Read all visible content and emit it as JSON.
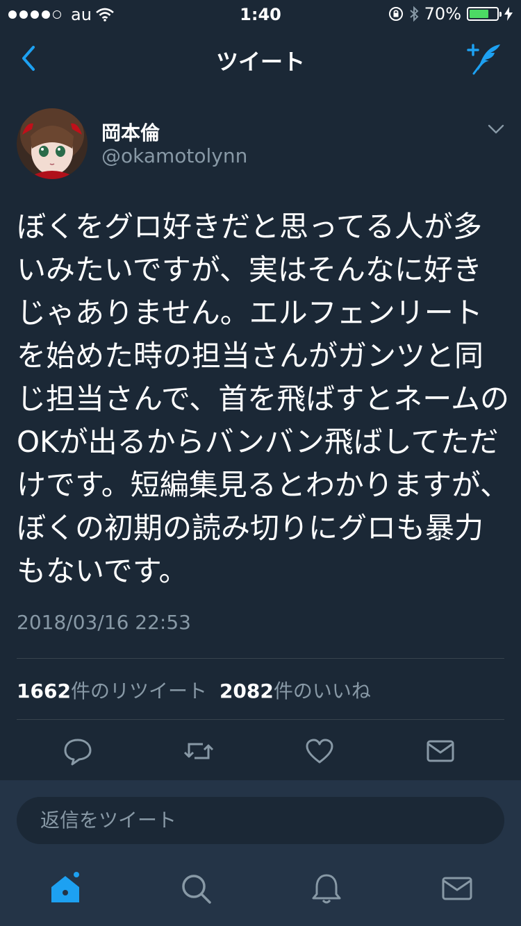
{
  "status_bar": {
    "carrier": "au",
    "time": "1:40",
    "battery": "70%",
    "battery_level": 0.7
  },
  "nav": {
    "title": "ツイート"
  },
  "tweet": {
    "display_name": "岡本倫",
    "handle": "@okamotolynn",
    "text": "ぼくをグロ好きだと思ってる人が多いみたいですが、実はそんなに好きじゃありません。エルフェンリートを始めた時の担当さんがガンツと同じ担当さんで、首を飛ばすとネームのOKが出るからバンバン飛ばしてただけです。短編集見るとわかりますが、ぼくの初期の読み切りにグロも暴力もないです。",
    "timestamp": "2018/03/16 22:53",
    "retweet_count": "1662",
    "retweet_label": "件のリツイート",
    "like_count": "2082",
    "like_label": "件のいいね"
  },
  "reply": {
    "placeholder": "返信をツイート"
  },
  "icons": {
    "back": "chevron-left-icon",
    "compose": "compose-tweet-icon",
    "menu": "chevron-down-icon",
    "reply": "reply-icon",
    "retweet": "retweet-icon",
    "like": "heart-icon",
    "dm": "envelope-icon",
    "home": "home-icon",
    "search": "search-icon",
    "notifications": "bell-icon",
    "messages": "envelope-icon"
  },
  "colors": {
    "background": "#1b2836",
    "accent": "#1da1f2",
    "secondary_text": "#8899a6",
    "battery": "#4cd964"
  }
}
